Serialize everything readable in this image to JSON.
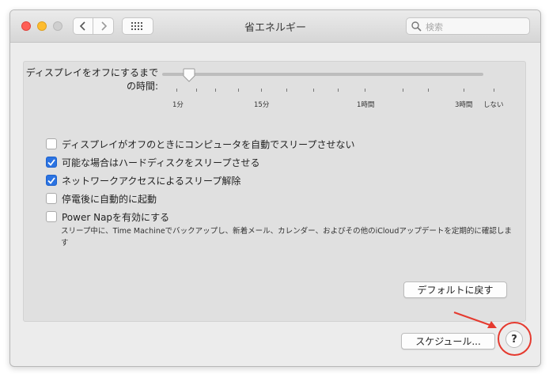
{
  "window": {
    "title": "省エネルギー",
    "search_placeholder": "検索"
  },
  "icons": {
    "back": "chevron-left-icon",
    "forward": "chevron-right-icon",
    "show_all": "grid-icon",
    "search": "magnifier-icon"
  },
  "display_sleep": {
    "label": "ディスプレイをオフにするまでの時間:",
    "label_line1": "ディスプレイをオフにするまで",
    "label_line2": "の時間:",
    "value_minutes": 3,
    "ticks": [
      "1分",
      "15分",
      "1時間",
      "3時間",
      "しない"
    ]
  },
  "options": [
    {
      "label": "ディスプレイがオフのときにコンピュータを自動でスリープさせない",
      "checked": false
    },
    {
      "label": "可能な場合はハードディスクをスリープさせる",
      "checked": true
    },
    {
      "label": "ネットワークアクセスによるスリープ解除",
      "checked": true
    },
    {
      "label": "停電後に自動的に起動",
      "checked": false
    },
    {
      "label": "Power Napを有効にする",
      "checked": false
    }
  ],
  "power_nap_description": "スリープ中に、Time Machineでバックアップし、新着メール、カレンダー、およびその他のiCloudアップデートを定期的に確認します",
  "buttons": {
    "restore_defaults": "デフォルトに戻す",
    "schedule": "スケジュール...",
    "help": "?"
  },
  "colors": {
    "accent": "#2b73e2",
    "annotation": "#e53a2f",
    "close": "#fe5f57",
    "minimize": "#febc2e"
  }
}
